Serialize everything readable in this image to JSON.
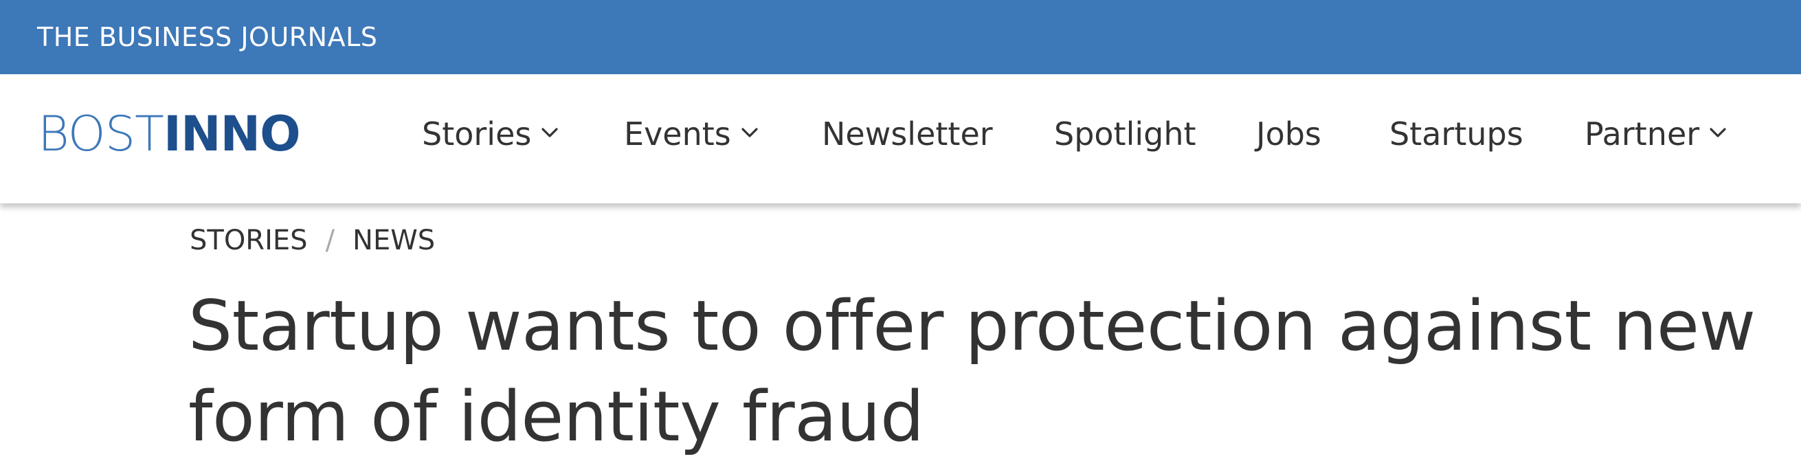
{
  "top_bar": {
    "brand": "THE BUSINESS JOURNALS",
    "background_color": "#3d78b9"
  },
  "navbar": {
    "logo": {
      "part_light": "BOST",
      "part_bold": "INNO",
      "color_light": "#3d78b9",
      "color_bold": "#1e4f8d"
    },
    "items": [
      {
        "label": "Stories",
        "has_dropdown": true,
        "icon": "chevron-down-icon"
      },
      {
        "label": "Events",
        "has_dropdown": true,
        "icon": "chevron-down-icon"
      },
      {
        "label": "Newsletter",
        "has_dropdown": false
      },
      {
        "label": "Spotlight",
        "has_dropdown": false
      },
      {
        "label": "Jobs",
        "has_dropdown": false
      },
      {
        "label": "Startups",
        "has_dropdown": false
      },
      {
        "label": "Partner",
        "has_dropdown": true,
        "icon": "chevron-down-icon"
      }
    ]
  },
  "breadcrumb": {
    "items": [
      "STORIES",
      "NEWS"
    ],
    "separator": "/"
  },
  "article": {
    "headline": "Startup wants to offer protection against new form of identity fraud"
  }
}
